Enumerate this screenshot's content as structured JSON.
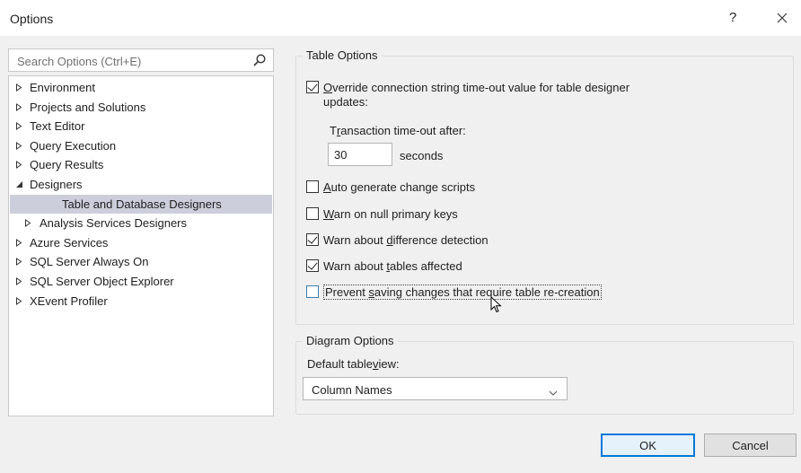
{
  "window": {
    "title": "Options",
    "help": "?",
    "close_icon": "close-icon"
  },
  "search": {
    "placeholder": "Search Options (Ctrl+E)",
    "icon": "search-icon"
  },
  "tree": [
    {
      "label": "Environment",
      "expanded": false
    },
    {
      "label": "Projects and Solutions",
      "expanded": false
    },
    {
      "label": "Text Editor",
      "expanded": false
    },
    {
      "label": "Query Execution",
      "expanded": false
    },
    {
      "label": "Query Results",
      "expanded": false
    },
    {
      "label": "Designers",
      "expanded": true
    },
    {
      "label": "Table and Database Designers",
      "selected": true
    },
    {
      "label": "Analysis Services Designers",
      "expanded": false
    },
    {
      "label": "Azure Services",
      "expanded": false
    },
    {
      "label": "SQL Server Always On",
      "expanded": false
    },
    {
      "label": "SQL Server Object Explorer",
      "expanded": false
    },
    {
      "label": "XEvent Profiler",
      "expanded": false
    }
  ],
  "table_options": {
    "title": "Table Options",
    "override": {
      "checked": true,
      "label_line1_mn": "O",
      "label_line1_rest": "verride connection string time-out value for table designer",
      "label_line2": "updates:"
    },
    "timeout_label_pre": "T",
    "timeout_label_mn": "r",
    "timeout_label_rest": "ansaction time-out after:",
    "timeout_value": "30",
    "timeout_unit": "seconds",
    "auto_generate": {
      "checked": false,
      "mn": "A",
      "rest": "uto generate change scripts"
    },
    "warn_null": {
      "checked": false,
      "mn": "W",
      "rest": "arn on null primary keys"
    },
    "warn_diff": {
      "checked": true,
      "pre": "Warn about ",
      "mn": "d",
      "rest": "ifference detection"
    },
    "warn_tables": {
      "checked": true,
      "pre": "Warn about ",
      "mn": "t",
      "rest": "ables affected"
    },
    "prevent_saving": {
      "checked": false,
      "pre": "Prevent ",
      "mn": "s",
      "rest": "aving changes that require table re-creation"
    }
  },
  "diagram_options": {
    "title": "Diagram Options",
    "default_view_pre": "Default table ",
    "default_view_mn": "v",
    "default_view_rest": "iew:",
    "selected": "Column Names"
  },
  "buttons": {
    "ok": "OK",
    "cancel": "Cancel"
  }
}
